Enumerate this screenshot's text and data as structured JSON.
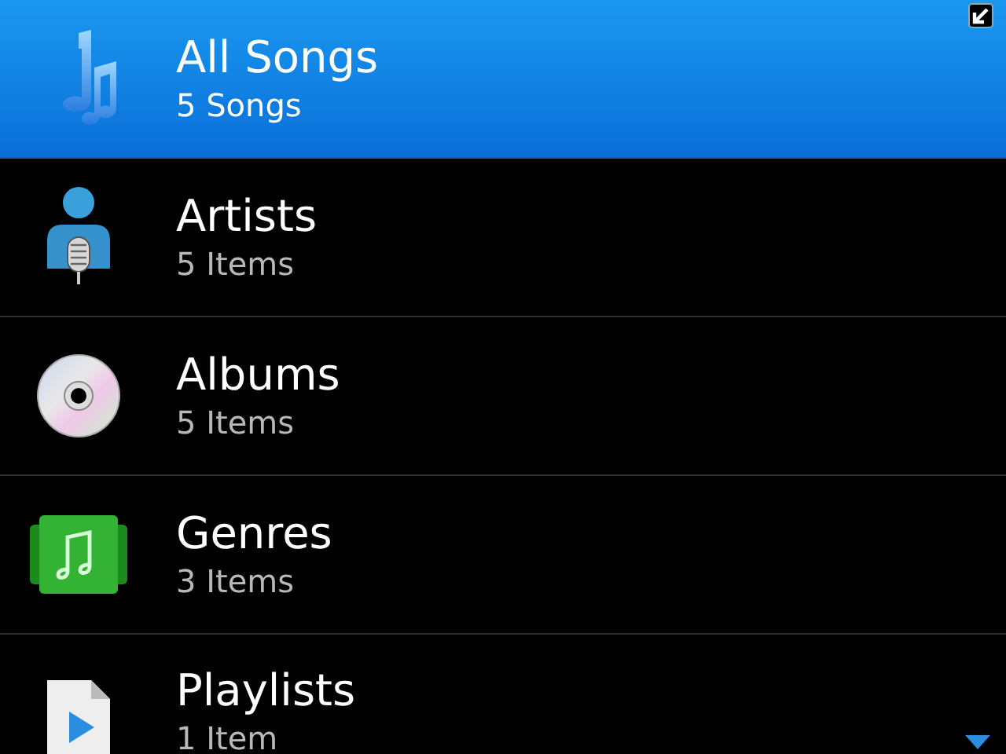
{
  "items": [
    {
      "kind": "songs",
      "title": "All Songs",
      "subtitle": "5 Songs",
      "selected": true
    },
    {
      "kind": "artists",
      "title": "Artists",
      "subtitle": "5 Items",
      "selected": false
    },
    {
      "kind": "albums",
      "title": "Albums",
      "subtitle": "5 Items",
      "selected": false
    },
    {
      "kind": "genres",
      "title": "Genres",
      "subtitle": "3 Items",
      "selected": false
    },
    {
      "kind": "playlists",
      "title": "Playlists",
      "subtitle": "1 Item",
      "selected": false
    }
  ]
}
